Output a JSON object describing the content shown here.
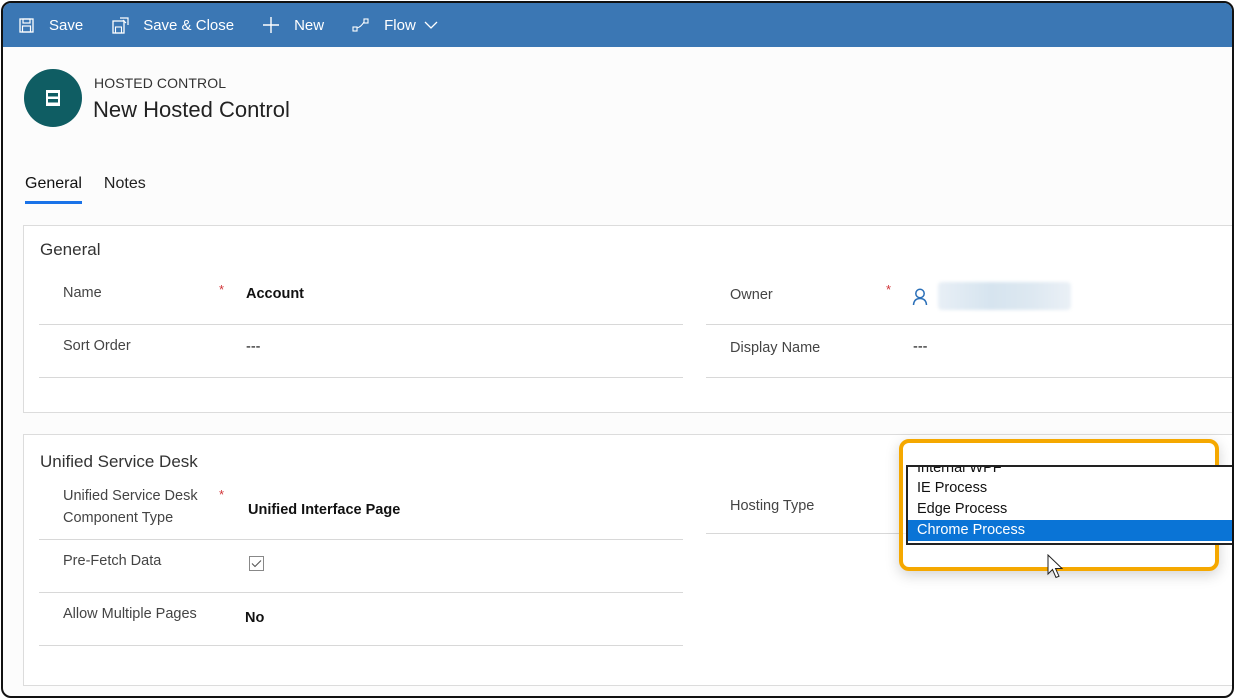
{
  "command_bar": {
    "save": {
      "label": "Save",
      "icon": "save-icon"
    },
    "save_close": {
      "label": "Save & Close",
      "icon": "save-close-icon"
    },
    "new": {
      "label": "New",
      "icon": "plus-icon"
    },
    "flow": {
      "label": "Flow",
      "icon": "flow-icon"
    }
  },
  "header": {
    "entity_type": "HOSTED CONTROL",
    "title": "New Hosted Control",
    "icon": "hosted-control-icon"
  },
  "tabs": [
    {
      "label": "General",
      "active": true
    },
    {
      "label": "Notes",
      "active": false
    }
  ],
  "sections": {
    "general": {
      "title": "General",
      "fields": {
        "name": {
          "label": "Name",
          "required": "*",
          "value": "Account"
        },
        "sort_order": {
          "label": "Sort Order",
          "value": "---"
        },
        "owner": {
          "label": "Owner",
          "required": "*",
          "value": ""
        },
        "display_name": {
          "label": "Display Name",
          "value": "---"
        }
      }
    },
    "usd": {
      "title": "Unified Service Desk",
      "fields": {
        "component_type": {
          "label_line1": "Unified Service Desk",
          "label_line2": "Component Type",
          "required": "*",
          "value": "Unified Interface Page"
        },
        "prefetch": {
          "label": "Pre-Fetch Data",
          "checked": true
        },
        "allow_multiple": {
          "label": "Allow Multiple Pages",
          "value": "No"
        },
        "hosting_type": {
          "label": "Hosting Type",
          "options": [
            "Internal WPF",
            "IE Process",
            "Edge Process",
            "Chrome Process"
          ],
          "selected": "Chrome Process"
        }
      }
    }
  },
  "colors": {
    "command_bar": "#3b77b4",
    "accent": "#1a73e8",
    "selection": "#0a74d6",
    "highlight": "#f5a800",
    "required": "#d13438",
    "entity_icon_bg": "#0f5d63"
  }
}
